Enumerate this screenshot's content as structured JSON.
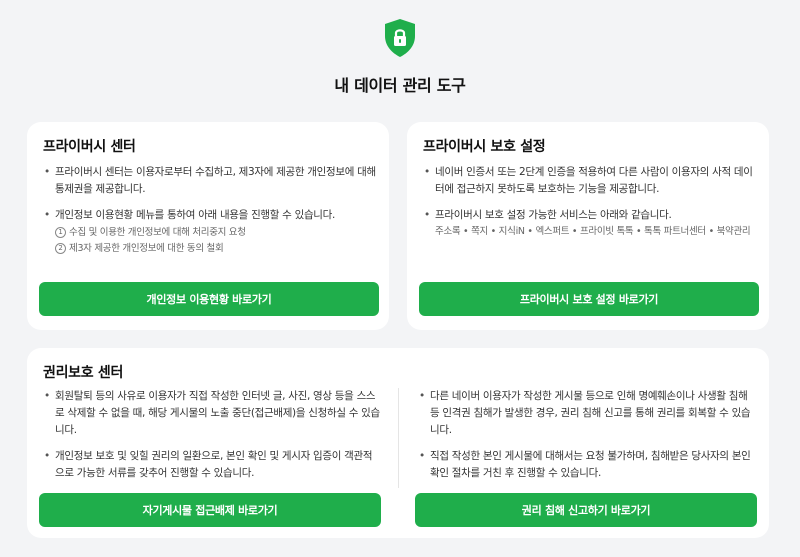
{
  "page": {
    "title": "내 데이터 관리 도구",
    "accent_color": "#1fae4b",
    "icon": "shield-lock-icon"
  },
  "privacy_center": {
    "title": "프라이버시 센터",
    "bullets": [
      "프라이버시 센터는 이용자로부터 수집하고, 제3자에 제공한 개인정보에 대해 통제권을 제공합니다.",
      "개인정보 이용현황 메뉴를 통하여 아래 내용을 진행할 수 있습니다."
    ],
    "sub_items": [
      {
        "num": "1",
        "text": "수집 및 이용한 개인정보에 대해 처리중지 요청"
      },
      {
        "num": "2",
        "text": "제3자 제공한 개인정보에 대한 동의 철회"
      }
    ],
    "button": "개인정보 이용현황 바로가기"
  },
  "privacy_settings": {
    "title": "프라이버시 보호 설정",
    "bullets": [
      "네이버 인증서 또는 2단계 인증을 적용하여 다른 사람이 이용자의 사적 데이터에 접근하지 못하도록 보호하는 기능을 제공합니다.",
      "프라이버시 보호 설정 가능한 서비스는 아래와 같습니다."
    ],
    "services": "주소록 • 쪽지 • 지식iN • 엑스퍼트 • 프라이빗 톡톡 • 톡톡 파트너센터 • 북약관리",
    "button": "프라이버시 보호 설정 바로가기"
  },
  "rights_center": {
    "title": "권리보호 센터",
    "left_bullets": [
      "회원탈퇴 등의 사유로 이용자가 직접 작성한 인터넷 글, 사진, 영상 등을 스스로 삭제할 수 없을 때, 해당 게시물의 노출 중단(접근배제)을 신청하실 수 있습니다.",
      "개인정보 보호 및 잊힐 권리의 일환으로, 본인 확인 및 게시자 입증이 객관적으로 가능한 서류를 갖추어 진행할 수 있습니다."
    ],
    "left_button": "자기게시물 접근배제 바로가기",
    "right_bullets": [
      "다른 네이버 이용자가 작성한 게시물 등으로 인해 명예훼손이나 사생활 침해 등 인격권 침해가 발생한 경우, 권리 침해 신고를 통해 권리를 회복할 수 있습니다.",
      "직접 작성한 본인 게시물에 대해서는 요청 불가하며, 침해받은 당사자의 본인 확인 절차를 거친 후 진행할 수 있습니다."
    ],
    "right_button": "권리 침해 신고하기 바로가기"
  }
}
